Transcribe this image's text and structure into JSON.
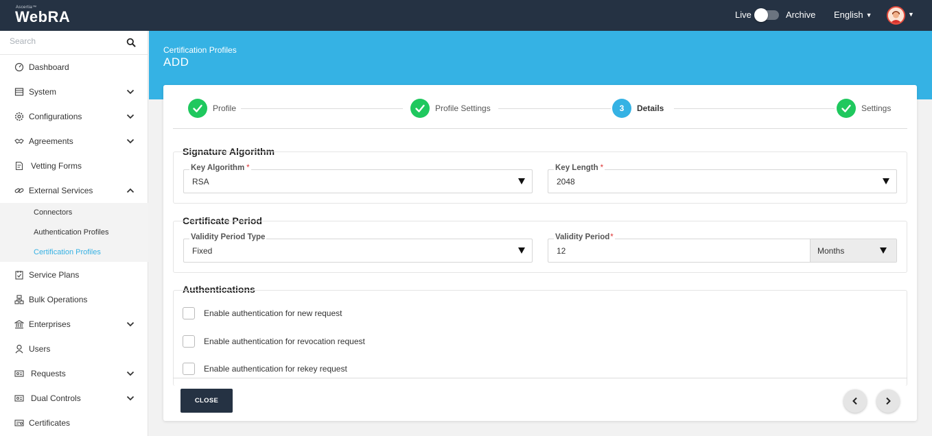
{
  "topbar": {
    "brand_small": "Ascertia™",
    "brand": "WebRA",
    "live_label": "Live",
    "archive_label": "Archive",
    "language": "English",
    "icons": [
      "toggle-icon",
      "caret-down-icon",
      "avatar-icon"
    ]
  },
  "sidebar": {
    "search_placeholder": "Search",
    "items": [
      {
        "label": "Dashboard",
        "icon": "dashboard-icon",
        "expandable": false
      },
      {
        "label": "System",
        "icon": "system-icon",
        "expandable": true
      },
      {
        "label": "Configurations",
        "icon": "gear-icon",
        "expandable": true
      },
      {
        "label": "Agreements",
        "icon": "handshake-icon",
        "expandable": true
      },
      {
        "label": "Vetting Forms",
        "icon": "form-icon",
        "expandable": false
      },
      {
        "label": "External Services",
        "icon": "link-icon",
        "expandable": true,
        "expanded": true
      },
      {
        "label": "Service Plans",
        "icon": "plan-icon",
        "expandable": false
      },
      {
        "label": "Bulk Operations",
        "icon": "bulk-icon",
        "expandable": false
      },
      {
        "label": "Enterprises",
        "icon": "bank-icon",
        "expandable": true
      },
      {
        "label": "Users",
        "icon": "user-icon",
        "expandable": false
      },
      {
        "label": "Requests",
        "icon": "requests-icon",
        "expandable": true
      },
      {
        "label": "Dual Controls",
        "icon": "dual-control-icon",
        "expandable": true
      },
      {
        "label": "Certificates",
        "icon": "certificate-icon",
        "expandable": false
      }
    ],
    "subitems": [
      {
        "label": "Connectors",
        "active": false
      },
      {
        "label": "Authentication Profiles",
        "active": false
      },
      {
        "label": "Certification Profiles",
        "active": true
      }
    ]
  },
  "header": {
    "breadcrumb": "Certification Profiles",
    "title": "ADD"
  },
  "stepper": {
    "steps": [
      {
        "label": "Profile",
        "state": "done",
        "number": ""
      },
      {
        "label": "Profile Settings",
        "state": "done",
        "number": ""
      },
      {
        "label": "Details",
        "state": "current",
        "number": "3"
      },
      {
        "label": "Settings",
        "state": "done",
        "number": ""
      }
    ]
  },
  "signature": {
    "title": "Signature Algorithm",
    "key_algorithm_label": "Key Algorithm",
    "key_algorithm_value": "RSA",
    "key_length_label": "Key Length",
    "key_length_value": "2048",
    "required_mark": "*"
  },
  "period": {
    "title": "Certificate Period",
    "type_label": "Validity Period Type",
    "type_value": "Fixed",
    "period_label": "Validity Period",
    "period_value": "12",
    "unit_value": "Months",
    "required_mark": "*"
  },
  "auth": {
    "title": "Authentications",
    "options": [
      {
        "label": "Enable authentication for new request",
        "checked": false
      },
      {
        "label": "Enable authentication for revocation request",
        "checked": false
      },
      {
        "label": "Enable authentication for rekey request",
        "checked": false
      }
    ]
  },
  "footer": {
    "close_label": "CLOSE",
    "icons": [
      "chevron-left-icon",
      "chevron-right-icon"
    ]
  },
  "colors": {
    "topbar": "#253243",
    "accent": "#35b2e4",
    "step_done": "#1fc85e",
    "required": "#dd3333"
  }
}
